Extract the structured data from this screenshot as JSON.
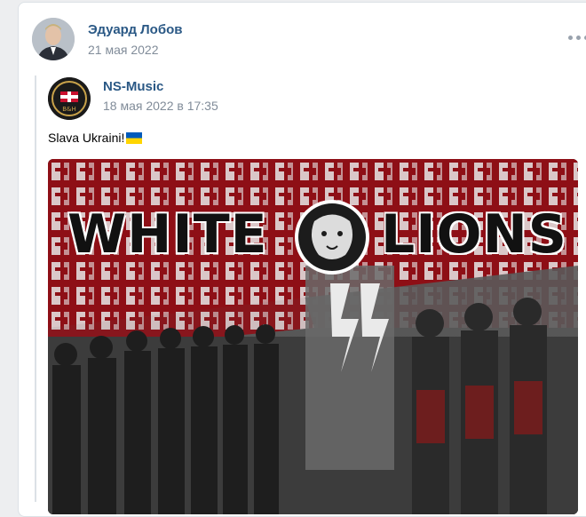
{
  "post": {
    "author_name": "Эдуард Лобов",
    "date": "21 мая 2022",
    "more_icon": "more-horizontal-icon"
  },
  "repost": {
    "source_name": "NS-Music",
    "date": "18 мая 2022 в 17:35",
    "text": "Slava Ukraini!",
    "flag_colors": [
      "#005bbb",
      "#ffd500"
    ]
  },
  "image": {
    "title_left": "WHITE",
    "title_right": "LIONS",
    "colors": {
      "ornament_red": "#b5121b",
      "photo_gray": "#4a4a4a"
    }
  }
}
